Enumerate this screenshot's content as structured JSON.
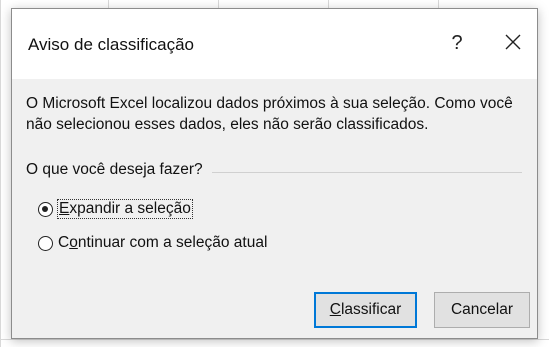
{
  "dialog": {
    "title": "Aviso de classificação",
    "help_label": "?",
    "close_icon": "close-icon",
    "message": "O Microsoft Excel localizou dados próximos à sua seleção. Como você não selecionou esses dados, eles não serão classificados.",
    "question": "O que você deseja fazer?",
    "options": [
      {
        "first": "E",
        "rest": "xpandir a seleção",
        "selected": true
      },
      {
        "first": "C",
        "mid": "o",
        "rest": "ntinuar com a seleção atual",
        "selected": false
      }
    ],
    "buttons": {
      "classify_first": "C",
      "classify_rest": "lassificar",
      "cancel": "Cancelar"
    },
    "colors": {
      "accent": "#0078d7",
      "dialog_bg": "#f0f0f0"
    }
  }
}
